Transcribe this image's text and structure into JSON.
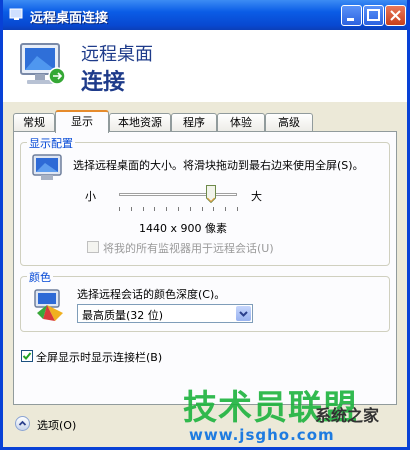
{
  "window": {
    "title": "远程桌面连接"
  },
  "header": {
    "line1": "远程桌面",
    "line2": "连接"
  },
  "tabs": [
    {
      "label": "常规",
      "active": false
    },
    {
      "label": "显示",
      "active": true
    },
    {
      "label": "本地资源",
      "active": false
    },
    {
      "label": "程序",
      "active": false
    },
    {
      "label": "体验",
      "active": false
    },
    {
      "label": "高级",
      "active": false
    }
  ],
  "display_config": {
    "group_label": "显示配置",
    "description": "选择远程桌面的大小。将滑块拖动到最右边来使用全屏(S)。",
    "slider_min_label": "小",
    "slider_max_label": "大",
    "slider_value_fraction": 0.78,
    "resolution": "1440 x 900 像素",
    "multimonitor_label": "将我的所有监视器用于远程会话(U)",
    "multimonitor_checked": false
  },
  "colors": {
    "group_label": "颜色",
    "description": "选择远程会话的颜色深度(C)。",
    "selected_depth": "最高质量(32 位)"
  },
  "connection_bar": {
    "label": "全屏显示时显示连接栏(B)",
    "checked": true
  },
  "footer": {
    "options_label": "选项(O)"
  },
  "watermark": {
    "main": "技术员联盟",
    "sub": "系统之家",
    "url": "www.jsgho.com"
  },
  "theme": {
    "title_blue": "#0a5ce6",
    "group_label_blue": "#0046d5",
    "tab_highlight": "#e68b2c",
    "watermark_green": "#1db33e"
  }
}
